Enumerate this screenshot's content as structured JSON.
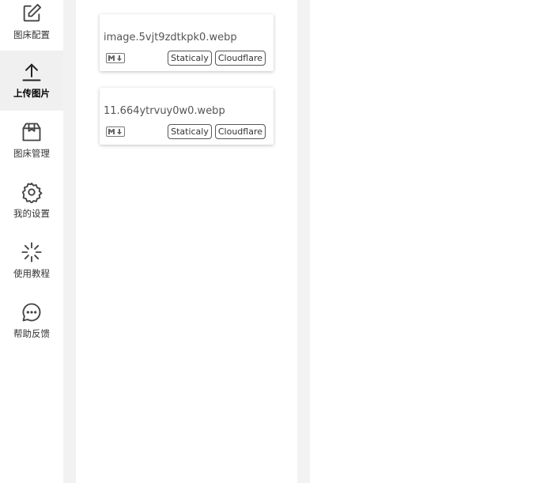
{
  "sidebar": {
    "items": [
      {
        "label": "图床配置",
        "icon": "edit-icon"
      },
      {
        "label": "上传图片",
        "icon": "upload-icon",
        "active": true
      },
      {
        "label": "图床管理",
        "icon": "box-icon"
      },
      {
        "label": "我的设置",
        "icon": "gear-icon"
      },
      {
        "label": "使用教程",
        "icon": "sparkle-icon"
      },
      {
        "label": "帮助反馈",
        "icon": "chat-icon"
      }
    ]
  },
  "uploads": [
    {
      "filename": "image.5vjt9zdtkpk0.webp",
      "format_icon": "markdown-icon",
      "tags": [
        "Staticaly",
        "Cloudflare"
      ]
    },
    {
      "filename": "11.664ytrvuy0w0.webp",
      "format_icon": "markdown-icon",
      "tags": [
        "Staticaly",
        "Cloudflare"
      ]
    }
  ],
  "colors": {
    "active_nav_bg": "#f0f0f0",
    "gutter": "#f2f2f2",
    "tag_border": "#555555"
  }
}
